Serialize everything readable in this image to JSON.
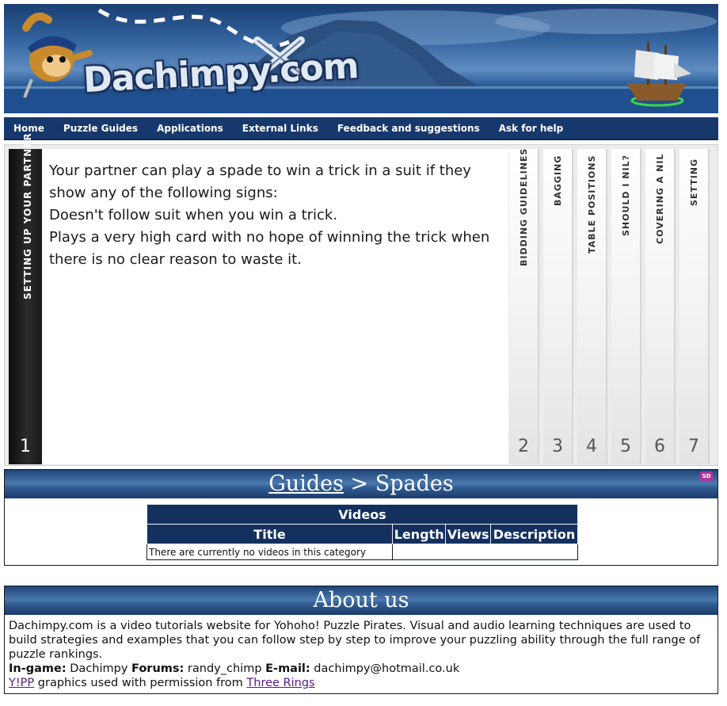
{
  "header": {
    "logo_text": "Dachimpy.com"
  },
  "nav": {
    "items": [
      "Home",
      "Puzzle Guides",
      "Applications",
      "External Links",
      "Feedback and suggestions",
      "Ask for help"
    ]
  },
  "accordion": {
    "active": {
      "label": "SETTING UP YOUR PARTNER",
      "number": "1"
    },
    "content": {
      "line1": "Your partner can play a spade to win a trick in a suit if they show any of the following signs:",
      "line2": "Doesn't follow suit when you win a trick.",
      "line3": "Plays a very high card with no hope of winning the trick when there is no clear reason to waste it."
    },
    "tabs": [
      {
        "label": "BIDDING GUIDELINES",
        "number": "2"
      },
      {
        "label": "BAGGING",
        "number": "3"
      },
      {
        "label": "TABLE POSITIONS",
        "number": "4"
      },
      {
        "label": "SHOULD I NIL?",
        "number": "5"
      },
      {
        "label": "COVERING A NIL",
        "number": "6"
      },
      {
        "label": "SETTING",
        "number": "7"
      }
    ]
  },
  "guides": {
    "link": "Guides",
    "separator": " > ",
    "current": "Spades",
    "badge": "SD",
    "videos": {
      "caption": "Videos",
      "columns": [
        "Title",
        "Length",
        "Views",
        "Description"
      ],
      "empty_message": "There are currently no videos in this category"
    }
  },
  "about": {
    "title": "About us",
    "description": "Dachimpy.com is a video tutorials website for Yohoho! Puzzle Pirates. Visual and audio learning techniques are used to build strategies and examples that you can follow step by step to improve your puzzling ability through the full range of puzzle rankings.",
    "ingame_label": "In-game:",
    "ingame_value": " Dachimpy ",
    "forums_label": "Forums:",
    "forums_value": " randy_chimp ",
    "email_label": "E-mail:",
    "email_value": " dachimpy@hotmail.co.uk",
    "yipp_link": "Y!PP",
    "credit_text": " graphics used with permission from ",
    "threerings_link": "Three Rings"
  },
  "colors": {
    "nav_bg": "#17386d",
    "table_header": "#14305f",
    "active_panel": "#1a1a1a"
  }
}
